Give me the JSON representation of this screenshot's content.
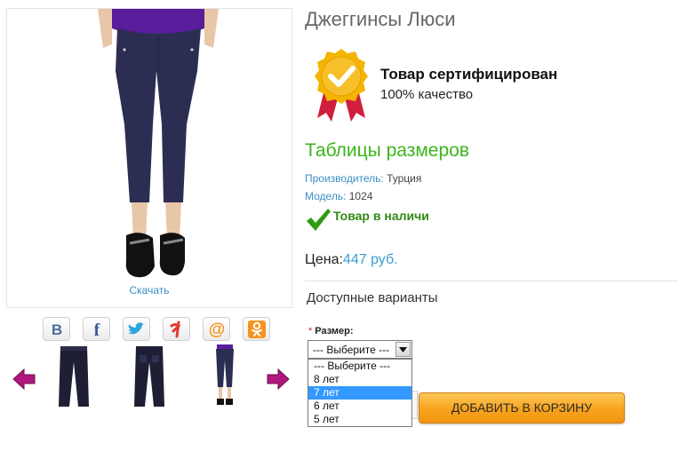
{
  "product": {
    "title": "Джеггинсы Люси",
    "download_link": "Скачать"
  },
  "certificate": {
    "title": "Товар сертифицирован",
    "subtitle": "100% качество"
  },
  "size_tables_link": "Таблицы размеров",
  "manufacturer": {
    "label": "Производитель:",
    "value": "Турция"
  },
  "model": {
    "label": "Модель:",
    "value": "1024"
  },
  "stock_status": "Товар в наличи",
  "price": {
    "label": "Цена:",
    "value": "447 руб."
  },
  "variants": {
    "title": "Доступные варианты",
    "size_label": "Размер:",
    "required_mark": "*",
    "selected": "--- Выберите ---",
    "options": [
      "--- Выберите ---",
      "8 лет",
      "7 лет",
      "6 лет",
      "5 лет"
    ],
    "highlighted_option": "7 лет"
  },
  "add_to_cart": "ДОБАВИТЬ В КОРЗИНУ",
  "social": [
    {
      "icon": "vk-icon",
      "glyph": "В",
      "color": "#4a6e9b"
    },
    {
      "icon": "facebook-icon",
      "glyph": "f",
      "color": "#3b5998"
    },
    {
      "icon": "twitter-icon",
      "glyph": "",
      "color": "#2ea4e0"
    },
    {
      "icon": "yaru-icon",
      "glyph": "я",
      "color": "#e23a32"
    },
    {
      "icon": "mailru-icon",
      "glyph": "@",
      "color": "#f7931e"
    },
    {
      "icon": "odnoklassniki-icon",
      "glyph": "ок",
      "color": "#f7931e"
    }
  ],
  "colors": {
    "accent_blue": "#3a8fc5",
    "green": "#3cb51b",
    "arrow_purple": "#b0177e",
    "button_orange": "#f7a21c"
  }
}
